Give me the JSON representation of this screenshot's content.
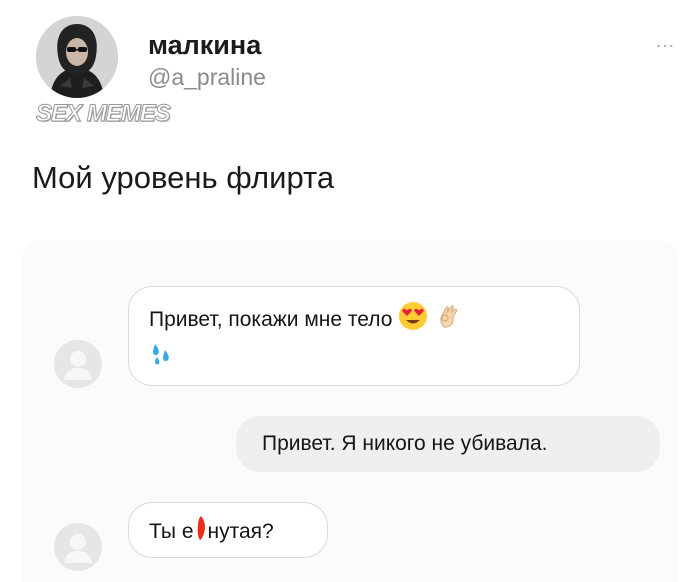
{
  "post": {
    "author_name": "малкина",
    "author_handle": "@a_praline",
    "more_icon": "…",
    "watermark": "SEX MEMES",
    "text": "Мой уровень флирта"
  },
  "chat": {
    "messages": [
      {
        "side": "incoming",
        "text": "Привет, покажи мне тело",
        "emojis": [
          "heart-eyes-emoji",
          "ok-hand-emoji",
          "sweat-droplets-emoji"
        ]
      },
      {
        "side": "outgoing",
        "text": "Привет. Я никого не убивала."
      },
      {
        "side": "incoming",
        "text_before": "Ты е",
        "text_after": "нутая?",
        "censor": "red-censor-mark"
      }
    ]
  }
}
